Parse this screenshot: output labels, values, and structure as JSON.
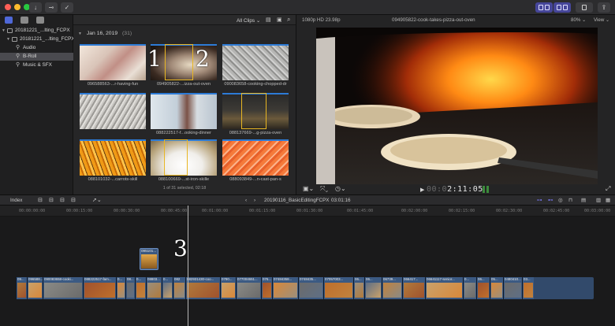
{
  "titlebar": {
    "colors": {
      "close": "#ff5f57",
      "minimize": "#febc2e",
      "zoom": "#28c840"
    }
  },
  "sidebar": {
    "items": [
      {
        "label": "20181221_...lting_FCPX",
        "kind": "library"
      },
      {
        "label": "20181221_...lting_FCPX",
        "kind": "event"
      },
      {
        "label": "Audio",
        "kind": "keyword"
      },
      {
        "label": "B-Roll",
        "kind": "keyword",
        "selected": true
      },
      {
        "label": "Music & SFX",
        "kind": "keyword"
      }
    ]
  },
  "browser": {
    "filter_label": "All Clips",
    "date_header": "Jan 16, 2019",
    "count": "(31)",
    "status": "1 of 31 selected, 02:18",
    "clips": [
      {
        "label": "096588563-...r-having-fun",
        "icon": "people-cooking-thumb"
      },
      {
        "label": "094905822-...izza-out-oven",
        "icon": "pizza-oven-thumb",
        "selected": true
      },
      {
        "label": "090083658-cooking-chopped-dr",
        "icon": "chopping-thumb"
      },
      {
        "label": "",
        "icon": "granite-thumb"
      },
      {
        "label": "088222517-f...ooking-dinner",
        "icon": "kitchen-thumb"
      },
      {
        "label": "088137669-...g-pizza-oven",
        "icon": "oven-thumb"
      },
      {
        "label": "088101032-...carrots-skill",
        "icon": "carrots-thumb"
      },
      {
        "label": "088100669-...st-iron-skille",
        "icon": "flour-thumb"
      },
      {
        "label": "088093849-...n-cast-pan-s",
        "icon": "salmon-thumb"
      }
    ]
  },
  "viewer": {
    "format": "1080p HD 23.98p",
    "clip_name": "094905822-cook-takes-pizza-out-oven",
    "zoom": "80%",
    "view_menu": "View",
    "timecode_dim": "00:0",
    "timecode": "2:11:05"
  },
  "timeline": {
    "index_label": "Index",
    "project_name": "20190116_BasicEditingFCPX",
    "duration": "03:01:16",
    "ruler_ticks": [
      "00:00:00:00",
      "00:00:15:00",
      "00:00:30:00",
      "00:00:45:00",
      "00:01:00:00",
      "00:01:15:00",
      "00:01:30:00",
      "00:01:45:00",
      "00:02:00:00",
      "00:02:15:00",
      "00:02:30:00",
      "00:02:45:00",
      "00:03:00:00"
    ],
    "connected_clip": "095101...",
    "clips": [
      {
        "label": "09...",
        "w": 14
      },
      {
        "label": "096588...",
        "w": 20
      },
      {
        "label": "090083658-cooki...",
        "w": 51
      },
      {
        "label": "088222517-fam...",
        "w": 42
      },
      {
        "label": "0...",
        "w": 12
      },
      {
        "label": "08...",
        "w": 12
      },
      {
        "label": "0...",
        "w": 14
      },
      {
        "label": "08803...",
        "w": 20
      },
      {
        "label": "0...",
        "w": 14
      },
      {
        "label": "082",
        "w": 16
      },
      {
        "label": "082931430-coo...",
        "w": 44
      },
      {
        "label": "0790...",
        "w": 20
      },
      {
        "label": "077004651...",
        "w": 32
      },
      {
        "label": "076...",
        "w": 14
      },
      {
        "label": "07484358...",
        "w": 33
      },
      {
        "label": "0748435...",
        "w": 32
      },
      {
        "label": "07057003...",
        "w": 38
      },
      {
        "label": "06...",
        "w": 14
      },
      {
        "label": "06...",
        "w": 22
      },
      {
        "label": "06739...",
        "w": 26
      },
      {
        "label": "066417...",
        "w": 29
      },
      {
        "label": "06641117-senior...",
        "w": 48
      },
      {
        "label": "0...",
        "w": 17
      },
      {
        "label": "06...",
        "w": 17
      },
      {
        "label": "05...",
        "w": 17
      },
      {
        "label": "0480410...",
        "w": 24
      },
      {
        "label": "03...",
        "w": 15
      }
    ]
  },
  "callouts": [
    "1",
    "2",
    "3"
  ]
}
